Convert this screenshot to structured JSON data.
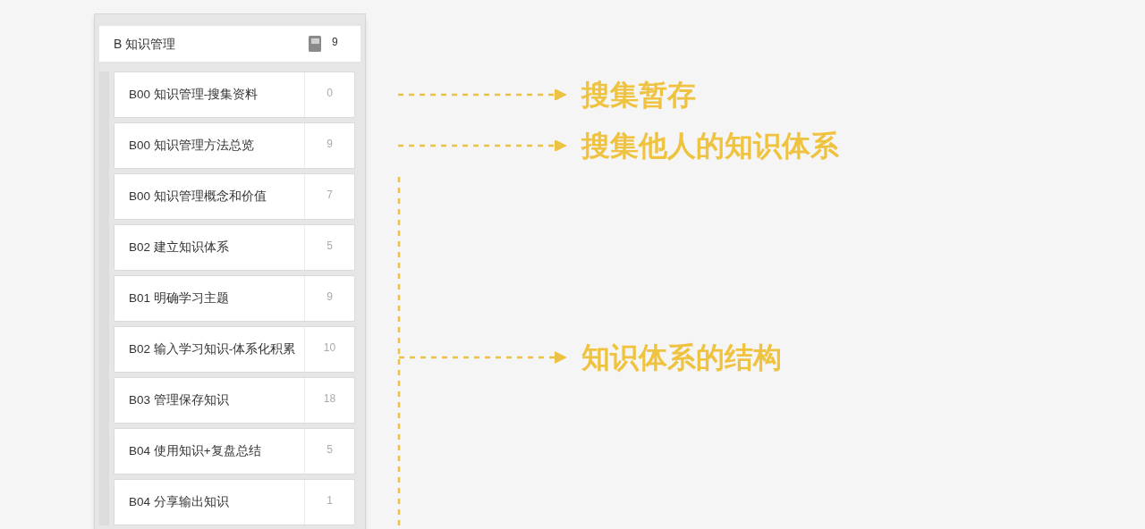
{
  "notebook": {
    "title": "B 知识管理",
    "count": "9"
  },
  "sections": [
    {
      "label": "B00 知识管理-搜集资料",
      "count": "0"
    },
    {
      "label": "B00 知识管理方法总览",
      "count": "9"
    },
    {
      "label": "B00 知识管理概念和价值",
      "count": "7"
    },
    {
      "label": "B02 建立知识体系",
      "count": "5"
    },
    {
      "label": "B01 明确学习主题",
      "count": "9"
    },
    {
      "label": "B02 输入学习知识-体系化积累",
      "count": "10"
    },
    {
      "label": "B03 管理保存知识",
      "count": "18"
    },
    {
      "label": "B04 使用知识+复盘总结",
      "count": "5"
    },
    {
      "label": "B04 分享输出知识",
      "count": "1"
    }
  ],
  "annotations": [
    {
      "kind": "arrow",
      "text": "搜集暂存"
    },
    {
      "kind": "arrow",
      "text": "搜集他人的知识体系"
    },
    {
      "kind": "bracket",
      "text": "知识体系的结构"
    }
  ]
}
